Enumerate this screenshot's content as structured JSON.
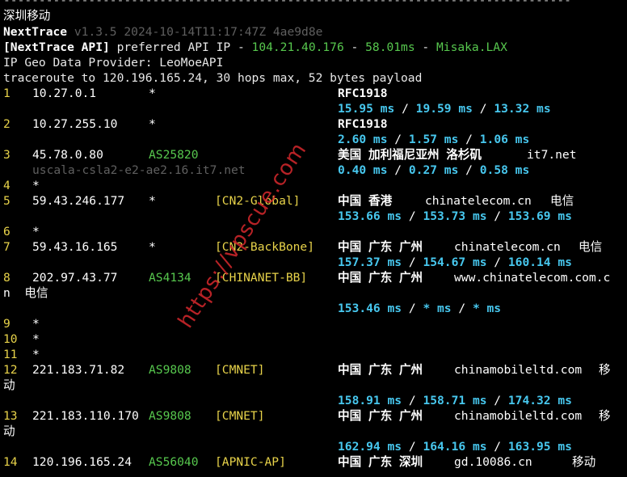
{
  "separator": "--------------------------------------------------------------------------------",
  "header": {
    "title": "深圳移动",
    "tool_name": "NextTrace",
    "tool_version": "v1.3.5 2024-10-14T11:17:47Z 4ae9d8e",
    "api_tag": "[NextTrace API]",
    "api_text": " preferred API IP - ",
    "api_ip": "104.21.40.176",
    "api_sep1": " - ",
    "api_latency": "58.01ms",
    "api_sep2": " - ",
    "api_node": "Misaka.LAX",
    "geo_provider": "IP Geo Data Provider: LeoMoeAPI",
    "traceroute": "traceroute to 120.196.165.24, 30 hops max, 52 bytes payload"
  },
  "hops": [
    {
      "no": "1",
      "ip": "10.27.0.1",
      "as": "*",
      "tag": "",
      "geo": "RFC1918",
      "timing": [
        "15.95 ms",
        "19.59 ms",
        "13.32 ms"
      ]
    },
    {
      "no": "2",
      "ip": "10.27.255.10",
      "as": "*",
      "tag": "",
      "geo": "RFC1918",
      "timing": [
        "2.60 ms",
        "1.57 ms",
        "1.06 ms"
      ]
    },
    {
      "no": "3",
      "ip": "45.78.0.80",
      "as": "AS25820",
      "tag": "",
      "geo": "美国 加利福尼亚州 洛杉矶",
      "domain": "it7.net",
      "rdns": "uscala-csla2-e2-ae2.16.it7.net",
      "timing": [
        "0.40 ms",
        "0.27 ms",
        "0.58 ms"
      ]
    },
    {
      "no": "4",
      "ip": "*"
    },
    {
      "no": "5",
      "ip": "59.43.246.177",
      "as": "*",
      "tag": "[CN2-Global]",
      "geo": "中国 香港",
      "domain": "chinatelecom.cn",
      "isp": "电信",
      "timing": [
        "153.66 ms",
        "153.73 ms",
        "153.69 ms"
      ]
    },
    {
      "no": "6",
      "ip": "*"
    },
    {
      "no": "7",
      "ip": "59.43.16.165",
      "as": "*",
      "tag": "[CN2-BackBone]",
      "geo": "中国 广东 广州",
      "domain": "chinatelecom.cn",
      "isp": "电信",
      "timing": [
        "157.37 ms",
        "154.67 ms",
        "160.14 ms"
      ]
    },
    {
      "no": "8",
      "ip": "202.97.43.77",
      "as": "AS4134",
      "tag": "[CHINANET-BB]",
      "geo": "中国 广东 广州",
      "domain": "www.chinatelecom.com.c",
      "wrap": "n  电信",
      "timing": [
        "153.46 ms",
        "* ms",
        "* ms"
      ]
    },
    {
      "no": "9",
      "ip": "*"
    },
    {
      "no": "10",
      "ip": "*"
    },
    {
      "no": "11",
      "ip": "*"
    },
    {
      "no": "12",
      "ip": "221.183.71.82",
      "as": "AS9808",
      "tag": "[CMNET]",
      "geo": "中国 广东 广州",
      "domain": "chinamobileltd.com",
      "isp": "移",
      "wrap": "动",
      "timing": [
        "158.91 ms",
        "158.71 ms",
        "174.32 ms"
      ]
    },
    {
      "no": "13",
      "ip": "221.183.110.170",
      "as": "AS9808",
      "tag": "[CMNET]",
      "geo": "中国 广东 广州",
      "domain": "chinamobileltd.com",
      "isp": "移",
      "wrap": "动",
      "timing": [
        "162.94 ms",
        "164.16 ms",
        "163.95 ms"
      ]
    },
    {
      "no": "14",
      "ip": "120.196.165.24",
      "as": "AS56040",
      "tag": "[APNIC-AP]",
      "geo": "中国 广东 深圳",
      "domain": "gd.10086.cn",
      "isp": "移动"
    }
  ],
  "timing_sep": " / ",
  "watermark": "https://vpscue.com",
  "colors": {
    "background": "#000000",
    "text": "#e8e8e8",
    "green": "#57c84e",
    "yellow": "#e8d34a",
    "cyan": "#47c7ee",
    "gray": "#5f5f5f",
    "watermark": "#d7282d"
  }
}
